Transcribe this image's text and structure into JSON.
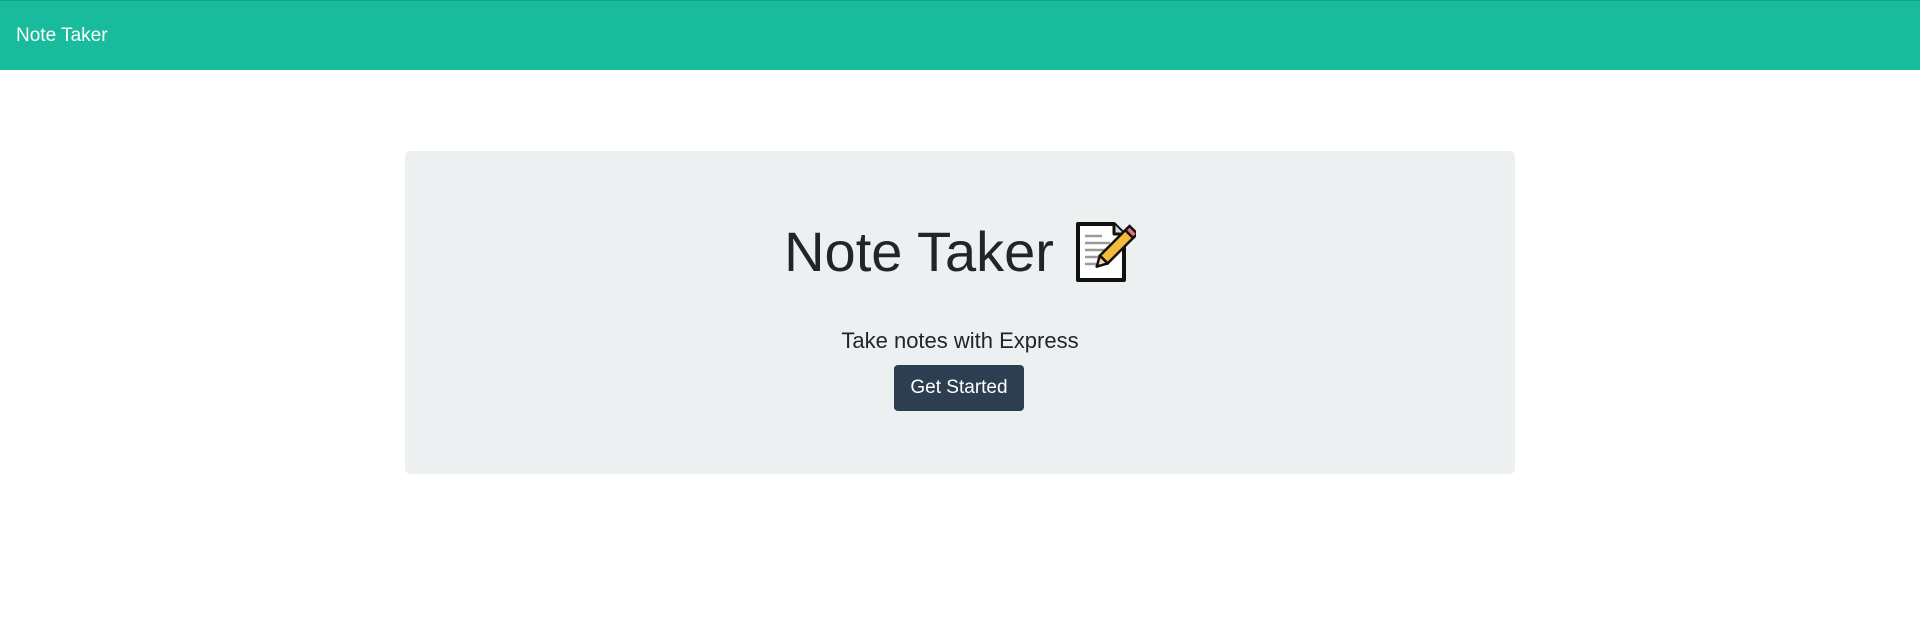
{
  "navbar": {
    "brand": "Note Taker",
    "color": "#18bc9c"
  },
  "hero": {
    "title": "Note Taker",
    "icon": "memo-icon",
    "subtitle": "Take notes with Express",
    "button_label": "Get Started",
    "background": "#ecf0f1",
    "button_color": "#2c3e50"
  }
}
